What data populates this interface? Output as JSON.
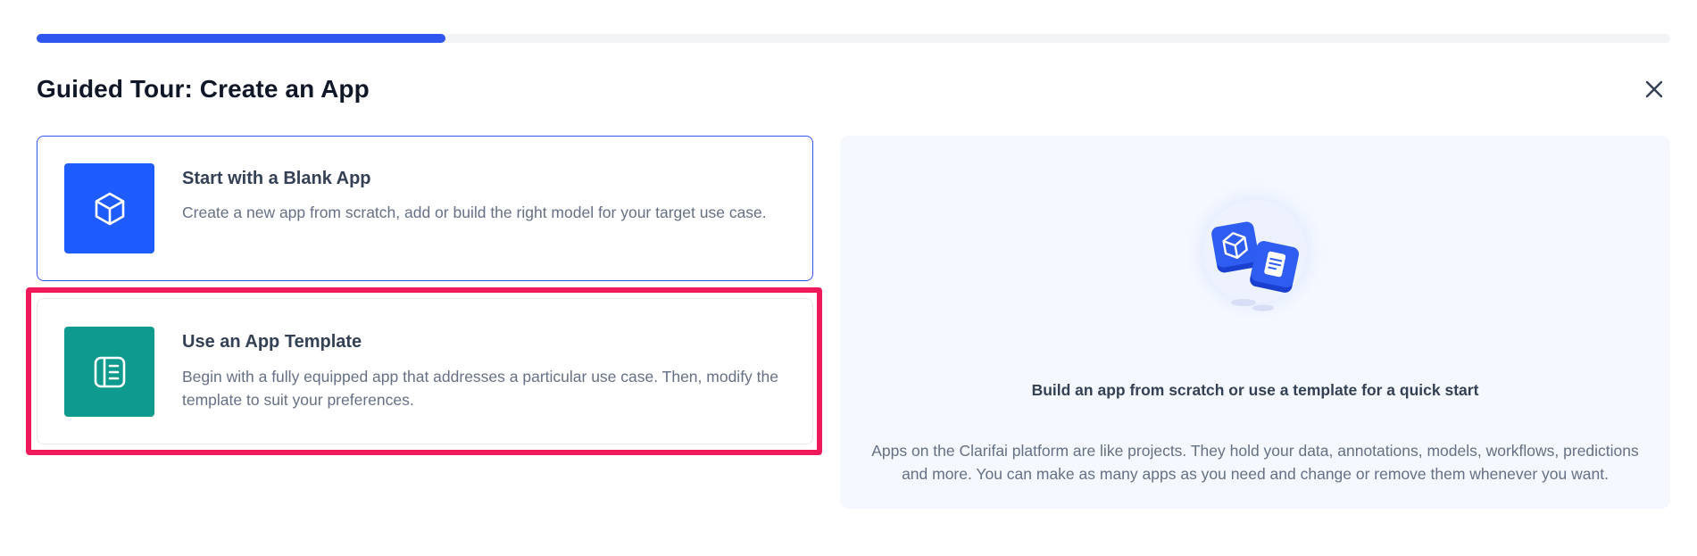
{
  "tour": {
    "title": "Guided Tour: Create an App",
    "progress_fraction": 0.25
  },
  "icons": {
    "close": "close-icon",
    "blank_app": "cube-icon",
    "template": "template-layout-icon"
  },
  "colors": {
    "accent": "#3056f0",
    "blank_tile": "#1f5cff",
    "template_tile": "#0f9a8e",
    "highlight": "#ee1a5b"
  },
  "options": [
    {
      "title": "Start with a Blank App",
      "description": "Create a new app from scratch, add or build the right model for your target use case."
    },
    {
      "title": "Use an App Template",
      "description": "Begin with a fully equipped app that addresses a particular use case. Then, modify the template to suit your preferences."
    }
  ],
  "info": {
    "heading": "Build an app from scratch or use a template for a quick start",
    "body": "Apps on the Clarifai platform are like projects. They hold your data, annotations, models, workflows, predictions and more. You can make as many apps as you need and change or remove them whenever you want."
  }
}
